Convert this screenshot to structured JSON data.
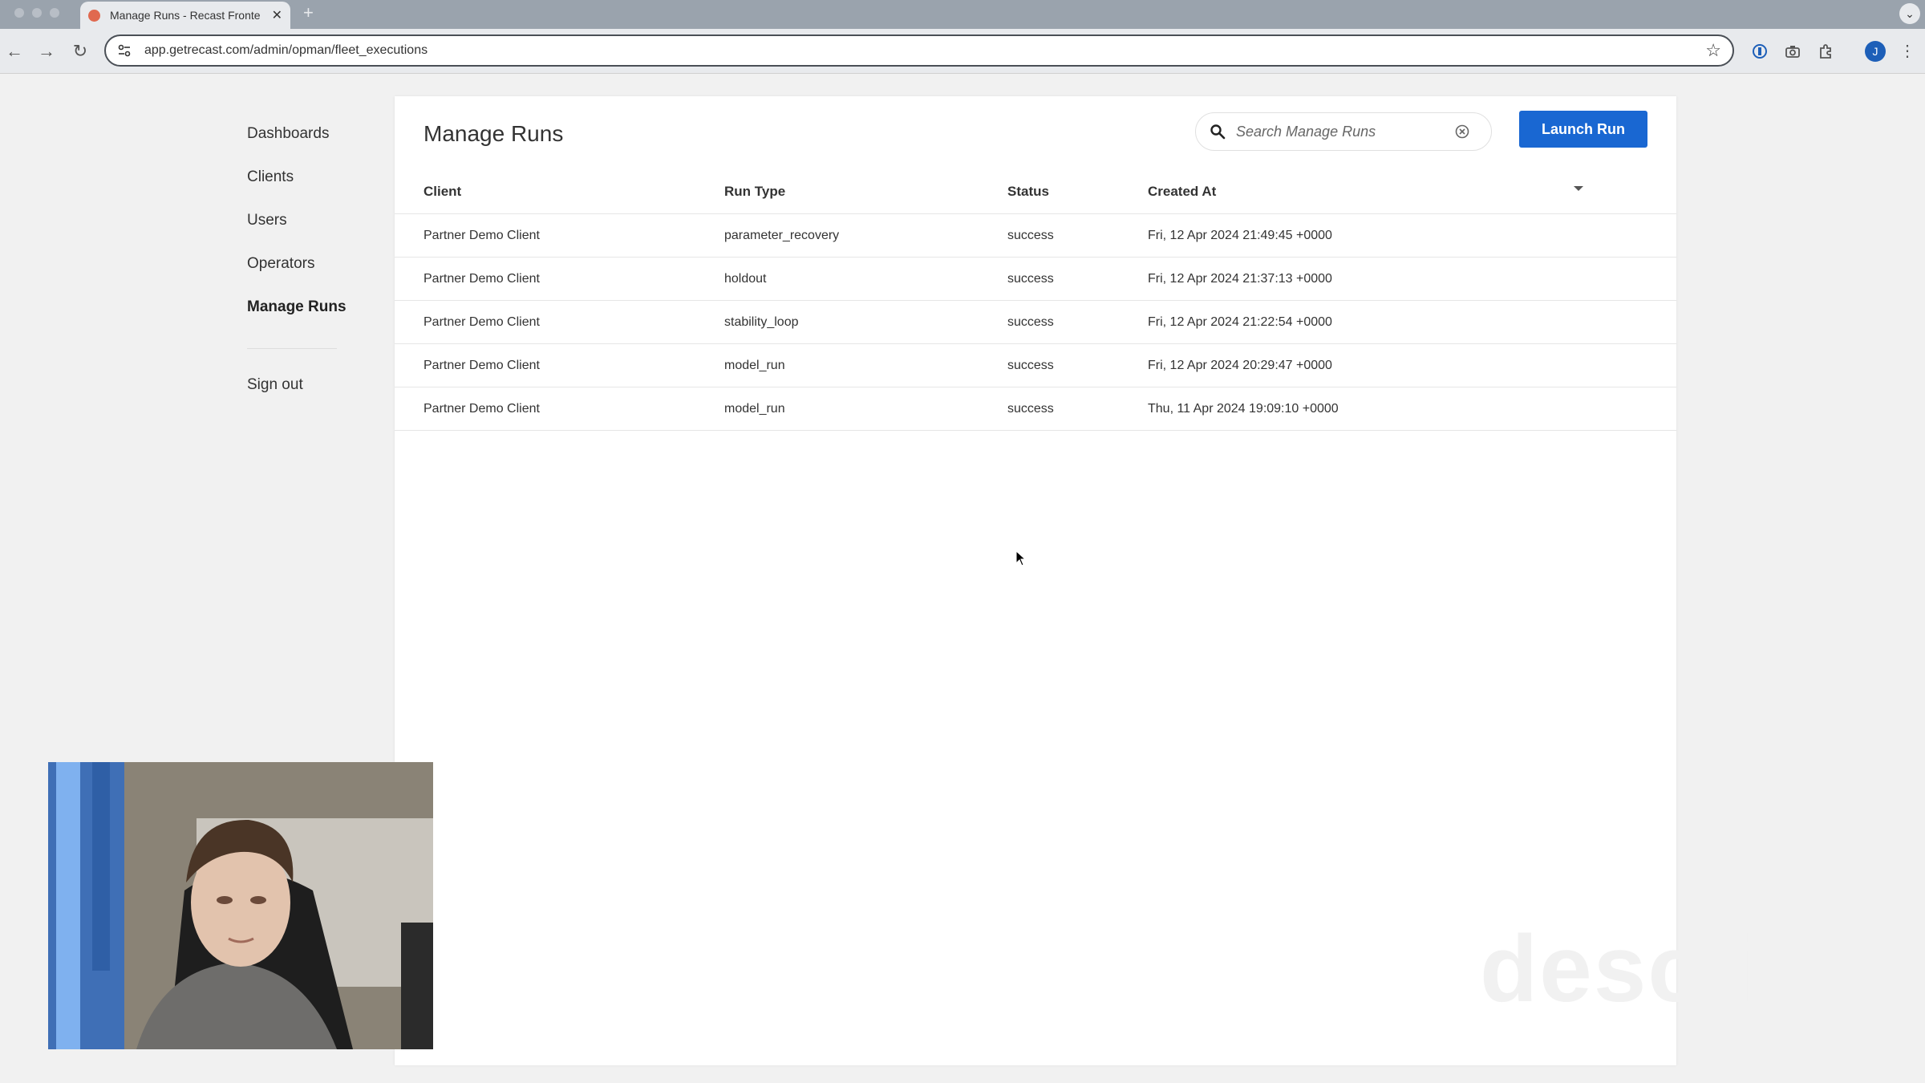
{
  "browser": {
    "tab_title": "Manage Runs - Recast Fronte",
    "new_tab_label": "+",
    "url": "app.getrecast.com/admin/opman/fleet_executions",
    "profile_initial": "J"
  },
  "sidebar": {
    "items": [
      {
        "label": "Dashboards",
        "active": false
      },
      {
        "label": "Clients",
        "active": false
      },
      {
        "label": "Users",
        "active": false
      },
      {
        "label": "Operators",
        "active": false
      },
      {
        "label": "Manage Runs",
        "active": true
      }
    ],
    "sign_out": "Sign out"
  },
  "page": {
    "title": "Manage Runs",
    "search_placeholder": "Search Manage Runs",
    "launch_button": "Launch Run"
  },
  "table": {
    "headers": {
      "client": "Client",
      "run_type": "Run Type",
      "status": "Status",
      "created_at": "Created At"
    },
    "rows": [
      {
        "client": "Partner Demo Client",
        "run_type": "parameter_recovery",
        "status": "success",
        "created_at": "Fri, 12 Apr 2024 21:49:45 +0000"
      },
      {
        "client": "Partner Demo Client",
        "run_type": "holdout",
        "status": "success",
        "created_at": "Fri, 12 Apr 2024 21:37:13 +0000"
      },
      {
        "client": "Partner Demo Client",
        "run_type": "stability_loop",
        "status": "success",
        "created_at": "Fri, 12 Apr 2024 21:22:54 +0000"
      },
      {
        "client": "Partner Demo Client",
        "run_type": "model_run",
        "status": "success",
        "created_at": "Fri, 12 Apr 2024 20:29:47 +0000"
      },
      {
        "client": "Partner Demo Client",
        "run_type": "model_run",
        "status": "success",
        "created_at": "Thu, 11 Apr 2024 19:09:10 +0000"
      }
    ]
  },
  "overlay": {
    "watermark": "descript"
  },
  "colors": {
    "accent": "#1967d2",
    "page_bg": "#f1f1f1",
    "card_bg": "#ffffff",
    "tabbar_bg": "#9aa3ad"
  },
  "icons": [
    "favicon-icon",
    "close-icon",
    "back-icon",
    "forward-icon",
    "reload-icon",
    "site-info-icon",
    "star-icon",
    "password-manager-icon",
    "camera-icon",
    "extensions-icon",
    "menu-icon",
    "search-icon",
    "clear-icon",
    "sort-caret-icon",
    "cursor-icon"
  ]
}
